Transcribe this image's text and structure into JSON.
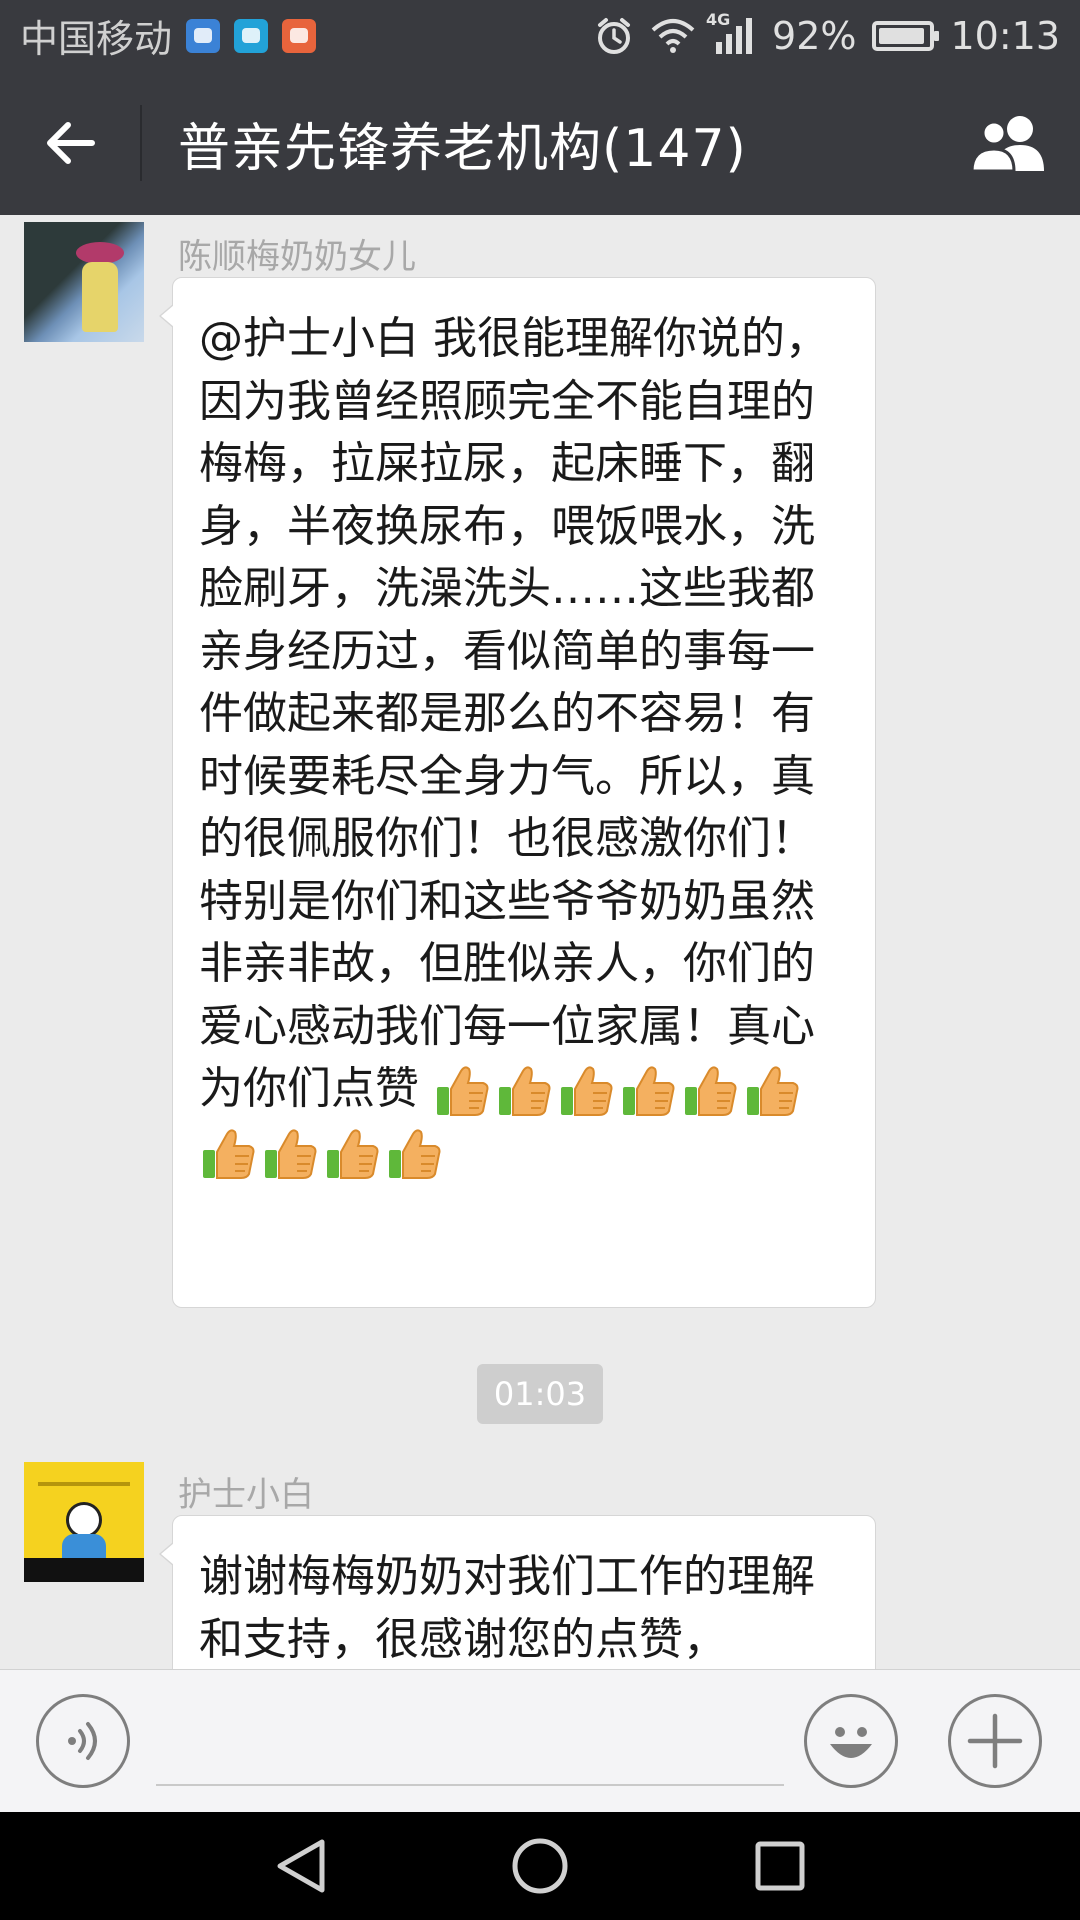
{
  "status_bar": {
    "carrier": "中国移动",
    "network": "4G",
    "battery": "92%",
    "time": "10:13"
  },
  "header": {
    "title": "普亲先锋养老机构(147)"
  },
  "messages": [
    {
      "sender": "陈顺梅奶奶女儿",
      "text": "@护士小白 我很能理解你说的，因为我曾经照顾完全不能自理的梅梅，拉屎拉尿，起床睡下，翻身，半夜换尿布，喂饭喂水，洗脸刷牙，洗澡洗头……这些我都亲身经历过，看似简单的事每一件做起来都是那么的不容易！有时候要耗尽全身力气。所以，真的很佩服你们！也很感激你们！特别是你们和这些爷爷奶奶虽然非亲非故，但胜似亲人，你们的爱心感动我们每一位家属！真心为你们点赞",
      "thumbs_up_count": 10
    },
    {
      "sender": "护士小白",
      "text": "谢谢梅梅奶奶对我们工作的理解和支持，很感谢您的点赞，"
    }
  ],
  "timestamp": "01:03",
  "input": {
    "value": ""
  },
  "colors": {
    "header_bg": "#393a3f",
    "chat_bg": "#ebebeb",
    "bubble_bg": "#ffffff"
  },
  "icons": {
    "back": "arrow-left-icon",
    "members": "group-icon",
    "voice": "voice-icon",
    "emoji": "emoji-icon",
    "more": "plus-icon"
  }
}
